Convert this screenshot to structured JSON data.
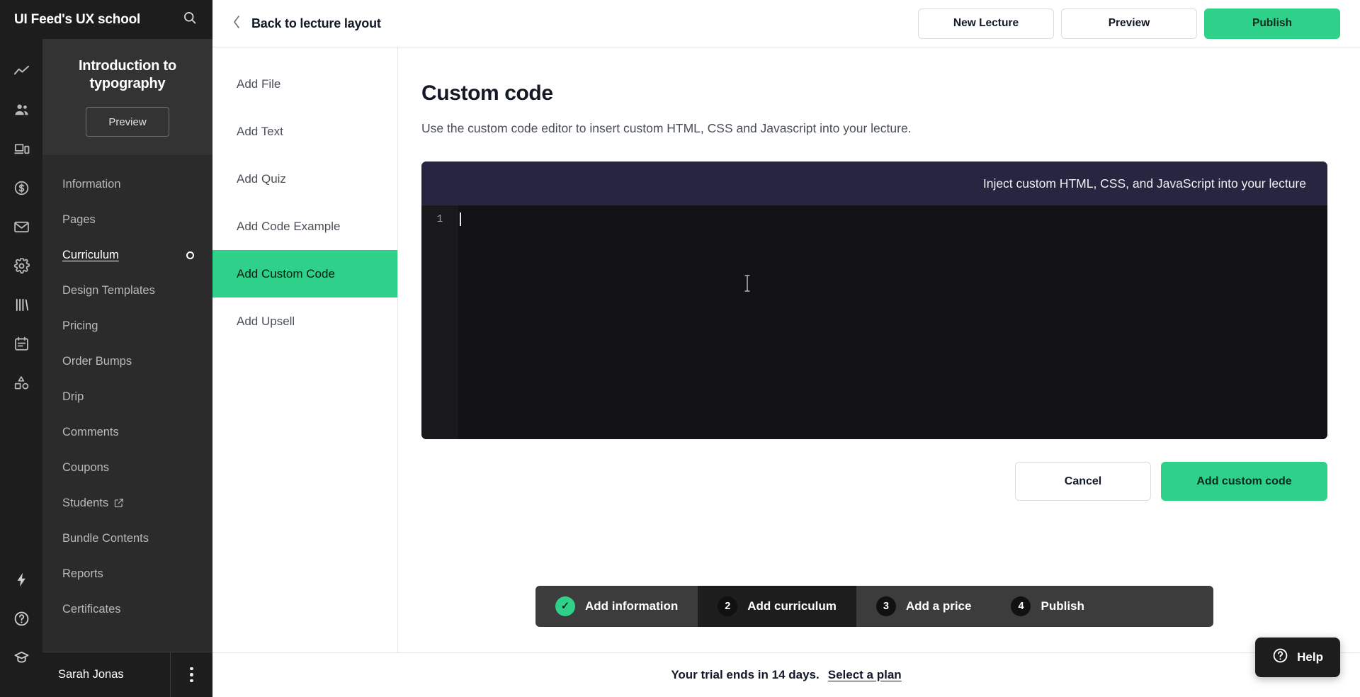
{
  "brand": {
    "name": "UI Feed's UX school",
    "search_icon": "search-icon"
  },
  "rail": {
    "icons": [
      {
        "name": "analytics-icon",
        "label": "Analytics"
      },
      {
        "name": "people-icon",
        "label": "Audience"
      },
      {
        "name": "devices-icon",
        "label": "Site"
      },
      {
        "name": "dollar-circle-icon",
        "label": "Sales"
      },
      {
        "name": "envelope-icon",
        "label": "Email"
      },
      {
        "name": "gear-icon",
        "label": "Settings"
      },
      {
        "name": "books-icon",
        "label": "Products"
      },
      {
        "name": "calendar-note-icon",
        "label": "Posts"
      },
      {
        "name": "shapes-icon",
        "label": "Design"
      }
    ],
    "bottom_icons": [
      {
        "name": "lightning-icon",
        "label": "Upgrades"
      },
      {
        "name": "question-circle-icon",
        "label": "Help"
      },
      {
        "name": "graduation-cap-icon",
        "label": "Academy"
      }
    ]
  },
  "sidebar": {
    "course_title": "Introduction to typography",
    "preview_label": "Preview",
    "items": [
      {
        "label": "Information",
        "active": false,
        "external": false,
        "indicator": false
      },
      {
        "label": "Pages",
        "active": false,
        "external": false,
        "indicator": false
      },
      {
        "label": "Curriculum",
        "active": true,
        "external": false,
        "indicator": true
      },
      {
        "label": "Design Templates",
        "active": false,
        "external": false,
        "indicator": false
      },
      {
        "label": "Pricing",
        "active": false,
        "external": false,
        "indicator": false
      },
      {
        "label": "Order Bumps",
        "active": false,
        "external": false,
        "indicator": false
      },
      {
        "label": "Drip",
        "active": false,
        "external": false,
        "indicator": false
      },
      {
        "label": "Comments",
        "active": false,
        "external": false,
        "indicator": false
      },
      {
        "label": "Coupons",
        "active": false,
        "external": false,
        "indicator": false
      },
      {
        "label": "Students",
        "active": false,
        "external": true,
        "indicator": false
      },
      {
        "label": "Bundle Contents",
        "active": false,
        "external": false,
        "indicator": false
      },
      {
        "label": "Reports",
        "active": false,
        "external": false,
        "indicator": false
      },
      {
        "label": "Certificates",
        "active": false,
        "external": false,
        "indicator": false
      }
    ],
    "user": {
      "name": "Sarah Jonas",
      "menu_icon": "kebab-menu-icon"
    }
  },
  "topbar": {
    "back_label": "Back to lecture layout",
    "back_icon": "chevron-left-icon",
    "new_lecture_label": "New Lecture",
    "preview_label": "Preview",
    "publish_label": "Publish"
  },
  "add_list": {
    "items": [
      {
        "label": "Add File",
        "active": false
      },
      {
        "label": "Add Text",
        "active": false
      },
      {
        "label": "Add Quiz",
        "active": false
      },
      {
        "label": "Add Code Example",
        "active": false
      },
      {
        "label": "Add Custom Code",
        "active": true
      },
      {
        "label": "Add Upsell",
        "active": false
      }
    ]
  },
  "main": {
    "title": "Custom code",
    "subtitle": "Use the custom code editor to insert custom HTML, CSS and Javascript into your lecture.",
    "editor": {
      "header_text": "Inject custom HTML, CSS, and JavaScript into your lecture",
      "line_number": "1",
      "content": ""
    },
    "cancel_label": "Cancel",
    "submit_label": "Add custom code"
  },
  "stepper": {
    "steps": [
      {
        "badge": "✓",
        "label": "Add information",
        "state": "done"
      },
      {
        "badge": "2",
        "label": "Add curriculum",
        "state": "active"
      },
      {
        "badge": "3",
        "label": "Add a price",
        "state": "pending"
      },
      {
        "badge": "4",
        "label": "Publish",
        "state": "pending"
      }
    ]
  },
  "trial": {
    "message": "Your trial ends in 14 days.",
    "link_label": "Select a plan"
  },
  "help": {
    "label": "Help",
    "icon": "question-circle-icon"
  },
  "colors": {
    "accent_green": "#2ed08a",
    "rail_bg": "#1d1d1d",
    "sidebar_bg": "#2b2b2b",
    "editor_header": "#262640",
    "editor_body": "#121214",
    "stepper_bg": "#3c3c3c"
  }
}
